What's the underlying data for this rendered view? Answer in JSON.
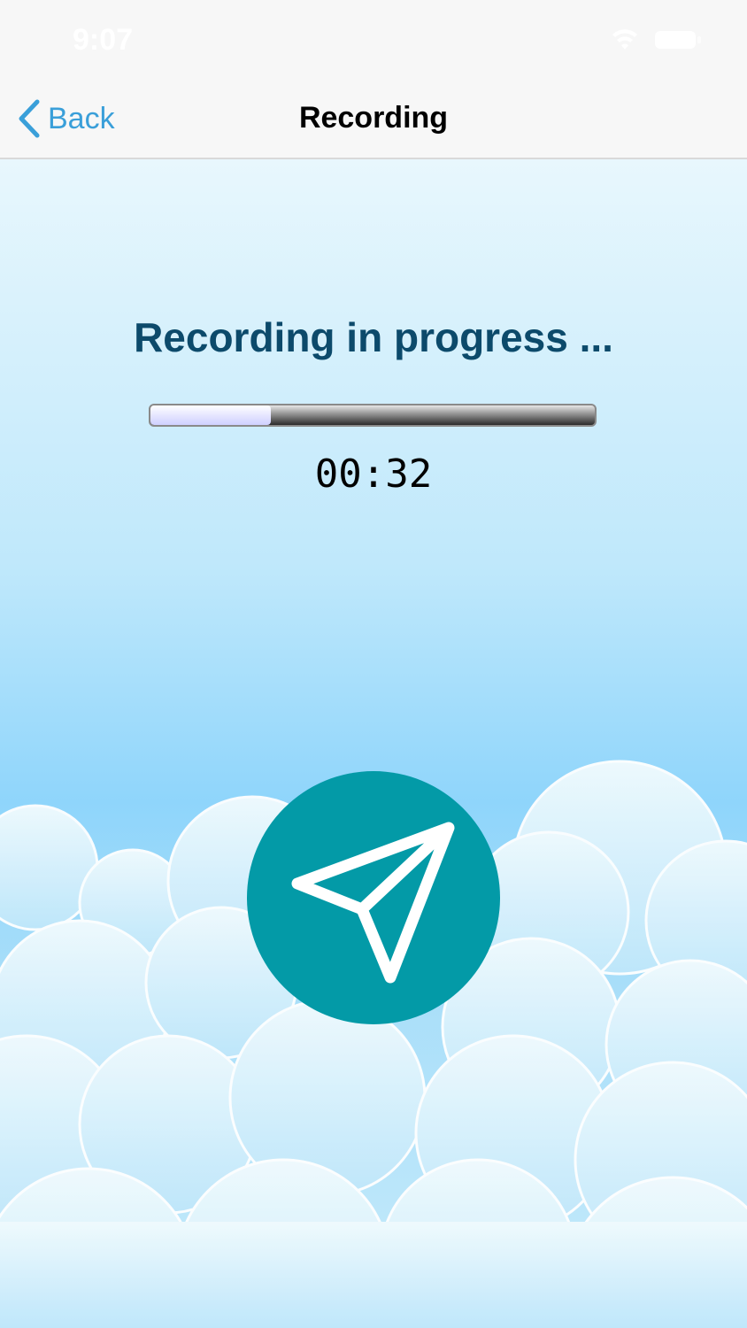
{
  "status_bar": {
    "time": "9:07"
  },
  "nav": {
    "back_label": "Back",
    "title": "Recording"
  },
  "recording": {
    "status_text": "Recording in progress ...",
    "progress_fraction": 0.27,
    "elapsed": "00:32"
  },
  "colors": {
    "accent": "#3a9fd9",
    "heading": "#0c4a6b",
    "send_button": "#039aa7"
  },
  "icons": {
    "back": "chevron-left-icon",
    "send": "paper-plane-icon",
    "wifi": "wifi-icon",
    "battery": "battery-icon"
  }
}
